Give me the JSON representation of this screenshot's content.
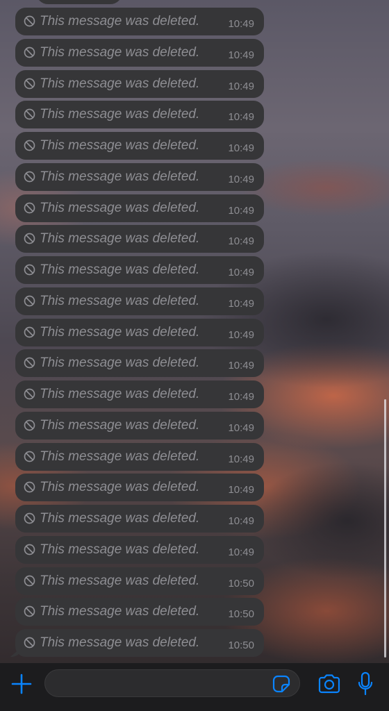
{
  "chat": {
    "messages": [
      {
        "text": "This message was deleted.",
        "time": "10:49",
        "icon": "block-icon"
      },
      {
        "text": "This message was deleted.",
        "time": "10:49",
        "icon": "block-icon"
      },
      {
        "text": "This message was deleted.",
        "time": "10:49",
        "icon": "block-icon"
      },
      {
        "text": "This message was deleted.",
        "time": "10:49",
        "icon": "block-icon"
      },
      {
        "text": "This message was deleted.",
        "time": "10:49",
        "icon": "block-icon"
      },
      {
        "text": "This message was deleted.",
        "time": "10:49",
        "icon": "block-icon"
      },
      {
        "text": "This message was deleted.",
        "time": "10:49",
        "icon": "block-icon"
      },
      {
        "text": "This message was deleted.",
        "time": "10:49",
        "icon": "block-icon"
      },
      {
        "text": "This message was deleted.",
        "time": "10:49",
        "icon": "block-icon"
      },
      {
        "text": "This message was deleted.",
        "time": "10:49",
        "icon": "block-icon"
      },
      {
        "text": "This message was deleted.",
        "time": "10:49",
        "icon": "block-icon"
      },
      {
        "text": "This message was deleted.",
        "time": "10:49",
        "icon": "block-icon"
      },
      {
        "text": "This message was deleted.",
        "time": "10:49",
        "icon": "block-icon"
      },
      {
        "text": "This message was deleted.",
        "time": "10:49",
        "icon": "block-icon"
      },
      {
        "text": "This message was deleted.",
        "time": "10:49",
        "icon": "block-icon"
      },
      {
        "text": "This message was deleted.",
        "time": "10:49",
        "icon": "block-icon"
      },
      {
        "text": "This message was deleted.",
        "time": "10:49",
        "icon": "block-icon"
      },
      {
        "text": "This message was deleted.",
        "time": "10:49",
        "icon": "block-icon"
      },
      {
        "text": "This message was deleted.",
        "time": "10:50",
        "icon": "block-icon"
      },
      {
        "text": "This message was deleted.",
        "time": "10:50",
        "icon": "block-icon"
      },
      {
        "text": "This message was deleted.",
        "time": "10:50",
        "icon": "block-icon"
      }
    ]
  },
  "input_bar": {
    "message_value": "",
    "icons": {
      "attach": "plus-icon",
      "sticker": "sticker-icon",
      "camera": "camera-icon",
      "voice": "microphone-icon"
    }
  },
  "colors": {
    "accent": "#0a84ff",
    "bubble": "#363638",
    "deleted_text": "#8e8e93",
    "input_bar": "#1c1c1e"
  }
}
